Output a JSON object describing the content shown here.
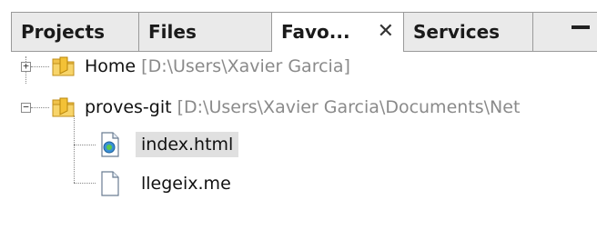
{
  "tabs": [
    {
      "label": "Projects"
    },
    {
      "label": "Files"
    },
    {
      "label": "Favo...",
      "close": "✕"
    },
    {
      "label": "Services"
    }
  ],
  "minimize_label": "—",
  "tree": {
    "home": {
      "name": "Home",
      "path": "[D:\\Users\\Xavier Garcia]"
    },
    "proves": {
      "name": "proves-git",
      "path": "[D:\\Users\\Xavier Garcia\\Documents\\Net"
    },
    "files": [
      {
        "name": "index.html"
      },
      {
        "name": "llegeix.me"
      }
    ]
  },
  "expanders": {
    "collapsed": "+",
    "expanded": "−"
  }
}
